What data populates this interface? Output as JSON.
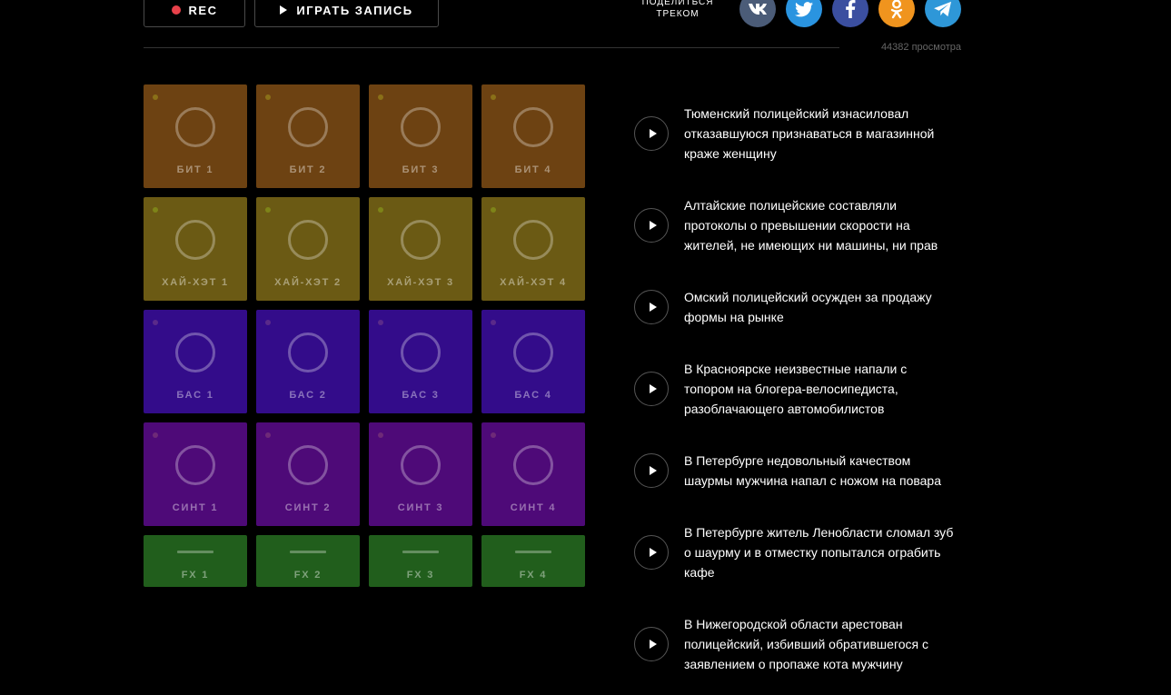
{
  "controls": {
    "rec_label": "REC",
    "play_label": "ИГРАТЬ ЗАПИСЬ"
  },
  "share": {
    "label": "ПОДЕЛИТЬСЯ ТРЕКОМ",
    "networks": [
      {
        "name": "vk-icon",
        "color": "#4b5c78"
      },
      {
        "name": "twitter-icon",
        "color": "#2a94e0"
      },
      {
        "name": "facebook-icon",
        "color": "#3b4fa0"
      },
      {
        "name": "odnoklassniki-icon",
        "color": "#f0941e"
      },
      {
        "name": "telegram-icon",
        "color": "#2e97d8"
      }
    ],
    "views": "44382 просмотра"
  },
  "pads": [
    {
      "label": "БИТ 1",
      "color": "#6d4212",
      "dot": "#8a7018"
    },
    {
      "label": "БИТ 2",
      "color": "#6d4212",
      "dot": "#8a7018"
    },
    {
      "label": "БИТ 3",
      "color": "#6d4212",
      "dot": "#8a7018"
    },
    {
      "label": "БИТ 4",
      "color": "#6d4212",
      "dot": "#8a7018"
    },
    {
      "label": "ХАЙ-ХЭТ 1",
      "color": "#6b5a14",
      "dot": "#7e8418"
    },
    {
      "label": "ХАЙ-ХЭТ 2",
      "color": "#6b5a14",
      "dot": "#7e8418"
    },
    {
      "label": "ХАЙ-ХЭТ 3",
      "color": "#6b5a14",
      "dot": "#7e8418"
    },
    {
      "label": "ХАЙ-ХЭТ 4",
      "color": "#6b5a14",
      "dot": "#7e8418"
    },
    {
      "label": "БАС 1",
      "color": "#330c8a",
      "dot": "#5a2a8a"
    },
    {
      "label": "БАС 2",
      "color": "#330c8a",
      "dot": "#5a2a8a"
    },
    {
      "label": "БАС 3",
      "color": "#330c8a",
      "dot": "#5a2a8a"
    },
    {
      "label": "БАС 4",
      "color": "#330c8a",
      "dot": "#5a2a8a"
    },
    {
      "label": "СИНТ 1",
      "color": "#4e0a78",
      "dot": "#6e2a78"
    },
    {
      "label": "СИНТ 2",
      "color": "#4e0a78",
      "dot": "#6e2a78"
    },
    {
      "label": "СИНТ 3",
      "color": "#4e0a78",
      "dot": "#6e2a78"
    },
    {
      "label": "СИНТ 4",
      "color": "#4e0a78",
      "dot": "#6e2a78"
    }
  ],
  "fx_pads": [
    {
      "label": "FX 1",
      "color": "#215e1c"
    },
    {
      "label": "FX 2",
      "color": "#215e1c"
    },
    {
      "label": "FX 3",
      "color": "#215e1c"
    },
    {
      "label": "FX 4",
      "color": "#215e1c"
    }
  ],
  "news": [
    "Тюменский полицейский изнасиловал отказавшуюся признаваться в магазинной краже женщину",
    "Алтайские полицейские составляли протоколы о превышении скорости на жителей, не имеющих ни машины, ни прав",
    "Омский полицейский осужден за продажу формы на рынке",
    "В Красноярске неизвестные напали с топором на блогера-велосипедиста, разоблачающего автомобилистов",
    "В Петербурге недовольный качеством шаурмы мужчина напал с ножом на повара",
    "В Петербурге житель Ленобласти сломал зуб о шаурму и в отместку попытался ограбить кафе",
    "В Нижегородской области арестован полицейский, избивший обратившегося с заявлением о пропаже кота мужчину"
  ]
}
